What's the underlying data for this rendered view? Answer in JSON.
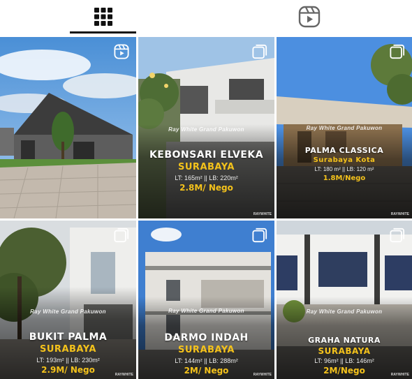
{
  "tabs": [
    {
      "name": "grid",
      "icon": "grid-icon",
      "active": true
    },
    {
      "name": "reels",
      "icon": "reels-icon",
      "active": false
    }
  ],
  "watermark": "Ray White Grand Pakuwon",
  "brand_corner": "RAYWHITE",
  "posts": [
    {
      "id": "p1",
      "icon": "reels-icon",
      "title": "",
      "city": "",
      "spec": "",
      "price": ""
    },
    {
      "id": "p2",
      "icon": "multi-post-icon",
      "title": "KEBONSARI ELVEKA",
      "city": "SURABAYA",
      "spec": "LT: 165m² || LB: 220m²",
      "price": "2.8M/ Nego"
    },
    {
      "id": "p3",
      "icon": "multi-post-icon",
      "title": "PALMA CLASSICA",
      "city": "Surabaya Kota",
      "spec": "LT: 180 m² || LB: 120 m²",
      "price": "1.8M/Nego"
    },
    {
      "id": "p4",
      "icon": "multi-post-icon",
      "title": "BUKIT PALMA",
      "city": "SURABAYA",
      "spec": "LT: 193m² || LB: 230m²",
      "price": "2.9M/ Nego"
    },
    {
      "id": "p5",
      "icon": "multi-post-icon",
      "title": "DARMO INDAH",
      "city": "SURABAYA",
      "spec": "LT: 144m² || LB: 288m²",
      "price": "2M/ Nego"
    },
    {
      "id": "p6",
      "icon": "multi-post-icon",
      "title": "GRAHA NATURA",
      "city": "SURABAYA",
      "spec": "LT: 96m² || LB: 146m²",
      "price": "2M/Nego"
    }
  ]
}
